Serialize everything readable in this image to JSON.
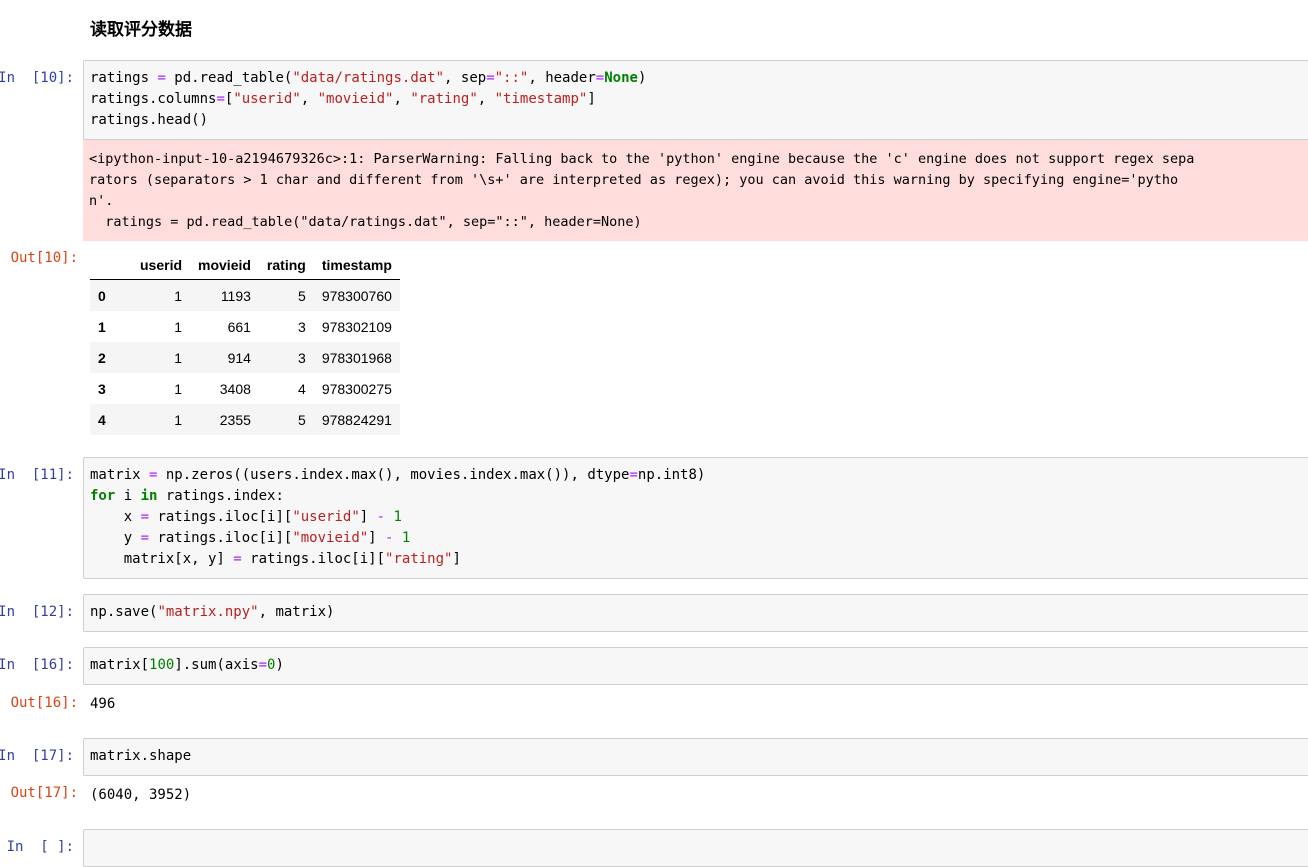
{
  "heading": "读取评分数据",
  "cells": {
    "c10": {
      "prompt_in": "In  [10]:",
      "prompt_out": "Out[10]:",
      "stderr": "<ipython-input-10-a2194679326c>:1: ParserWarning: Falling back to the 'python' engine because the 'c' engine does not support regex sepa\nrators (separators > 1 char and different from '\\s+' are interpreted as regex); you can avoid this warning by specifying engine='pytho\nn'.\n  ratings = pd.read_table(\"data/ratings.dat\", sep=\"::\", header=None)",
      "table": {
        "columns": [
          "",
          "userid",
          "movieid",
          "rating",
          "timestamp"
        ],
        "rows": [
          [
            "0",
            "1",
            "1193",
            "5",
            "978300760"
          ],
          [
            "1",
            "1",
            "661",
            "3",
            "978302109"
          ],
          [
            "2",
            "1",
            "914",
            "3",
            "978301968"
          ],
          [
            "3",
            "1",
            "3408",
            "4",
            "978300275"
          ],
          [
            "4",
            "1",
            "2355",
            "5",
            "978824291"
          ]
        ]
      }
    },
    "c11": {
      "prompt_in": "In  [11]:"
    },
    "c12": {
      "prompt_in": "In  [12]:"
    },
    "c16": {
      "prompt_in": "In  [16]:",
      "prompt_out": "Out[16]:",
      "output": "496"
    },
    "c17": {
      "prompt_in": "In  [17]:",
      "prompt_out": "Out[17]:",
      "output": "(6040, 3952)"
    },
    "cnew": {
      "prompt_in": "In  [ ]:"
    }
  }
}
